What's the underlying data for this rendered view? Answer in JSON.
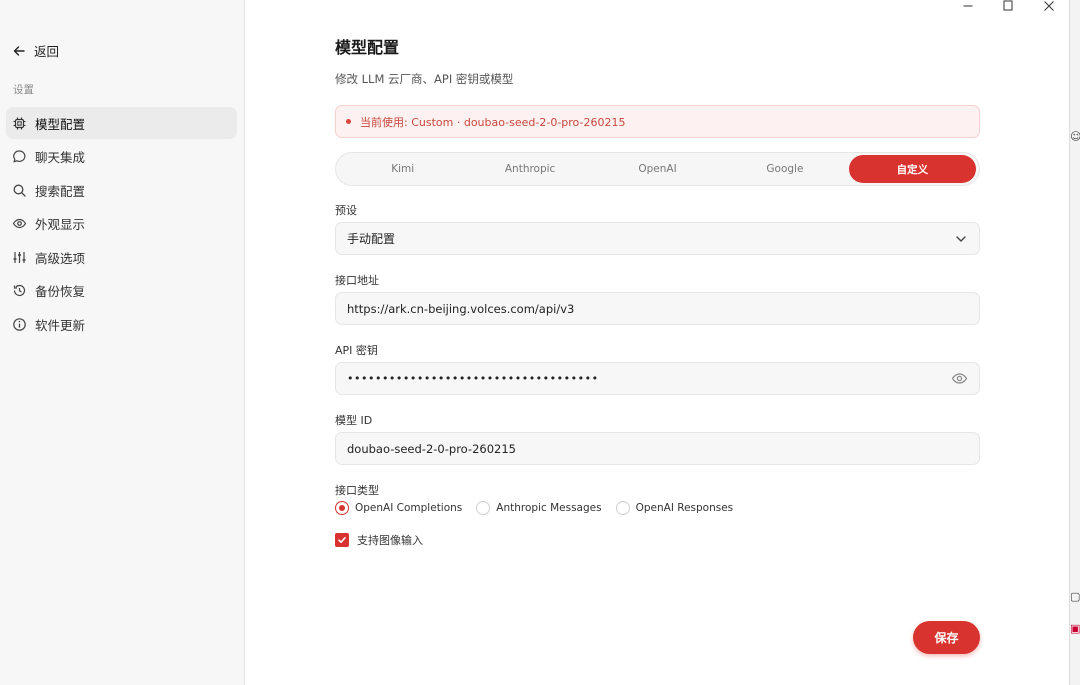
{
  "sidebar": {
    "back_label": "返回",
    "section_label": "设置",
    "items": [
      {
        "label": "模型配置",
        "icon": "chip-icon",
        "active": true
      },
      {
        "label": "聊天集成",
        "icon": "chat-bubble-icon"
      },
      {
        "label": "搜索配置",
        "icon": "search-icon"
      },
      {
        "label": "外观显示",
        "icon": "eye-icon"
      },
      {
        "label": "高级选项",
        "icon": "sliders-icon"
      },
      {
        "label": "备份恢复",
        "icon": "history-icon"
      },
      {
        "label": "软件更新",
        "icon": "info-icon"
      }
    ]
  },
  "main": {
    "title": "模型配置",
    "subtitle": "修改 LLM 云厂商、API 密钥或模型",
    "notice": "当前使用: Custom · doubao-seed-2-0-pro-260215",
    "tabs": [
      "Kimi",
      "Anthropic",
      "OpenAI",
      "Google",
      "自定义"
    ],
    "active_tab": "自定义",
    "preset": {
      "label": "预设",
      "value": "手动配置"
    },
    "endpoint": {
      "label": "接口地址",
      "value": "https://ark.cn-beijing.volces.com/api/v3"
    },
    "api_key": {
      "label": "API 密钥",
      "value": "••••••••••••••••••••••••••••••••••••"
    },
    "model_id": {
      "label": "模型 ID",
      "value": "doubao-seed-2-0-pro-260215"
    },
    "api_type": {
      "label": "接口类型",
      "options": [
        "OpenAI Completions",
        "Anthropic Messages",
        "OpenAI Responses"
      ],
      "selected": "OpenAI Completions"
    },
    "image_input": {
      "label": "支持图像输入",
      "checked": true
    },
    "save_label": "保存"
  },
  "colors": {
    "accent": "#d9332f",
    "notice_bg": "#fdf2f1",
    "notice_text": "#c9463d",
    "sidebar_bg": "#f7f7f7"
  }
}
